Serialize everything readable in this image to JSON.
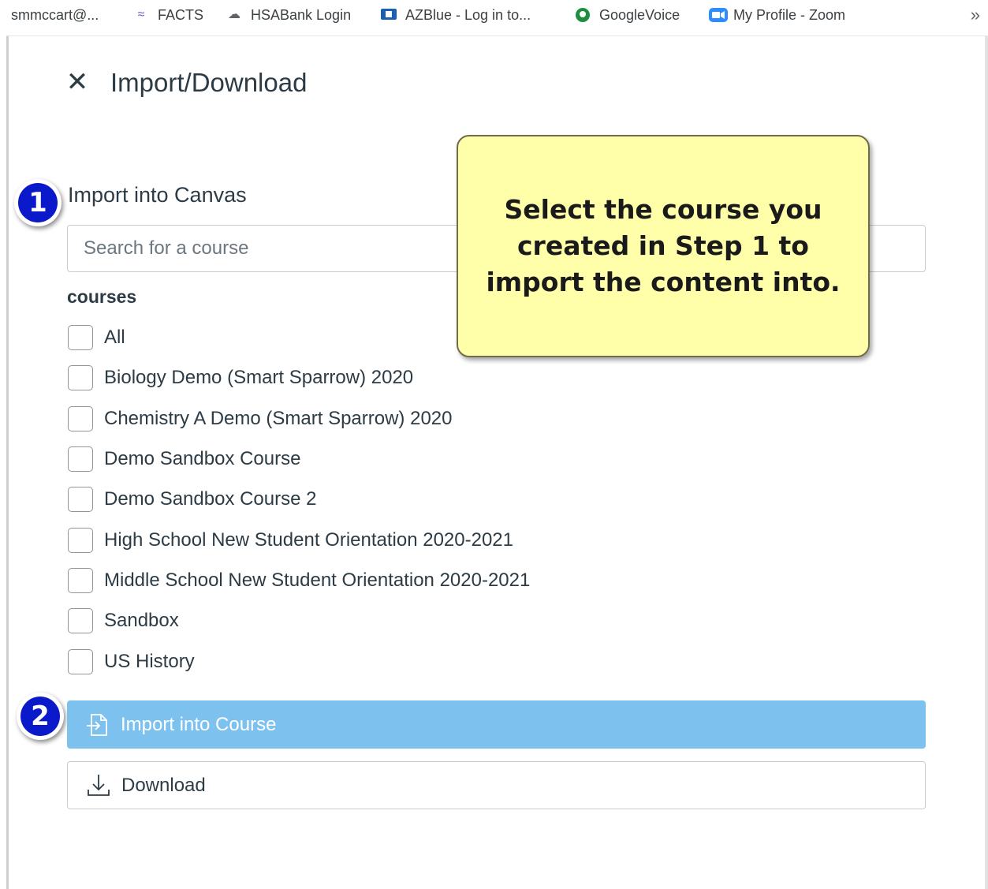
{
  "bookmarks": [
    {
      "label": "smmccart@...",
      "icon": "account-icon"
    },
    {
      "label": "FACTS",
      "icon": "facts-icon"
    },
    {
      "label": "HSABank Login",
      "icon": "cloud-icon"
    },
    {
      "label": "AZBlue - Log in to...",
      "icon": "azblue-icon"
    },
    {
      "label": "GoogleVoice",
      "icon": "google-voice-icon"
    },
    {
      "label": "My Profile - Zoom",
      "icon": "zoom-icon"
    }
  ],
  "bookmarks_more": "»",
  "dialog": {
    "close_glyph": "✕",
    "title": "Import/Download"
  },
  "markers": {
    "one": "1",
    "two": "2"
  },
  "import_section": {
    "label": "Import into Canvas",
    "search_placeholder": "Search for a course",
    "courses_heading": "courses",
    "courses": [
      "All",
      "Biology Demo (Smart Sparrow) 2020",
      "Chemistry A Demo (Smart Sparrow) 2020",
      "Demo Sandbox Course",
      "Demo Sandbox Course 2",
      "High School New Student Orientation 2020-2021",
      "Middle School New Student Orientation 2020-2021",
      "Sandbox",
      "US History"
    ]
  },
  "callout": {
    "line1": "Select the course you",
    "line2": "created in Step 1 to",
    "line3": "import the content into."
  },
  "buttons": {
    "import_label": "Import into Course",
    "download_label": "Download"
  },
  "colors": {
    "marker_blue": "#0a19c9",
    "import_button": "#7dc2ef",
    "callout_fill": "#ffffaa",
    "text": "#2d3b45"
  }
}
